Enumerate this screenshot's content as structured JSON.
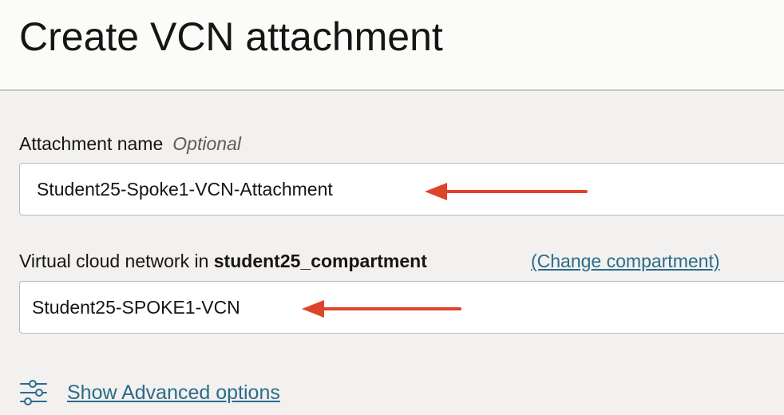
{
  "dialog": {
    "title": "Create VCN attachment"
  },
  "attachment_name": {
    "label": "Attachment name",
    "optional_tag": "Optional",
    "value": "Student25-Spoke1-VCN-Attachment"
  },
  "vcn": {
    "label_prefix": "Virtual cloud network in",
    "compartment": "student25_compartment",
    "change_link": "(Change compartment)",
    "selected": "Student25-SPOKE1-VCN"
  },
  "advanced": {
    "link_label": "Show Advanced options",
    "icon": "sliders-icon"
  },
  "colors": {
    "link": "#2b6b8a",
    "arrow": "#e0432b",
    "background": "#f2f1ef",
    "header_background": "#fbfbfa"
  }
}
